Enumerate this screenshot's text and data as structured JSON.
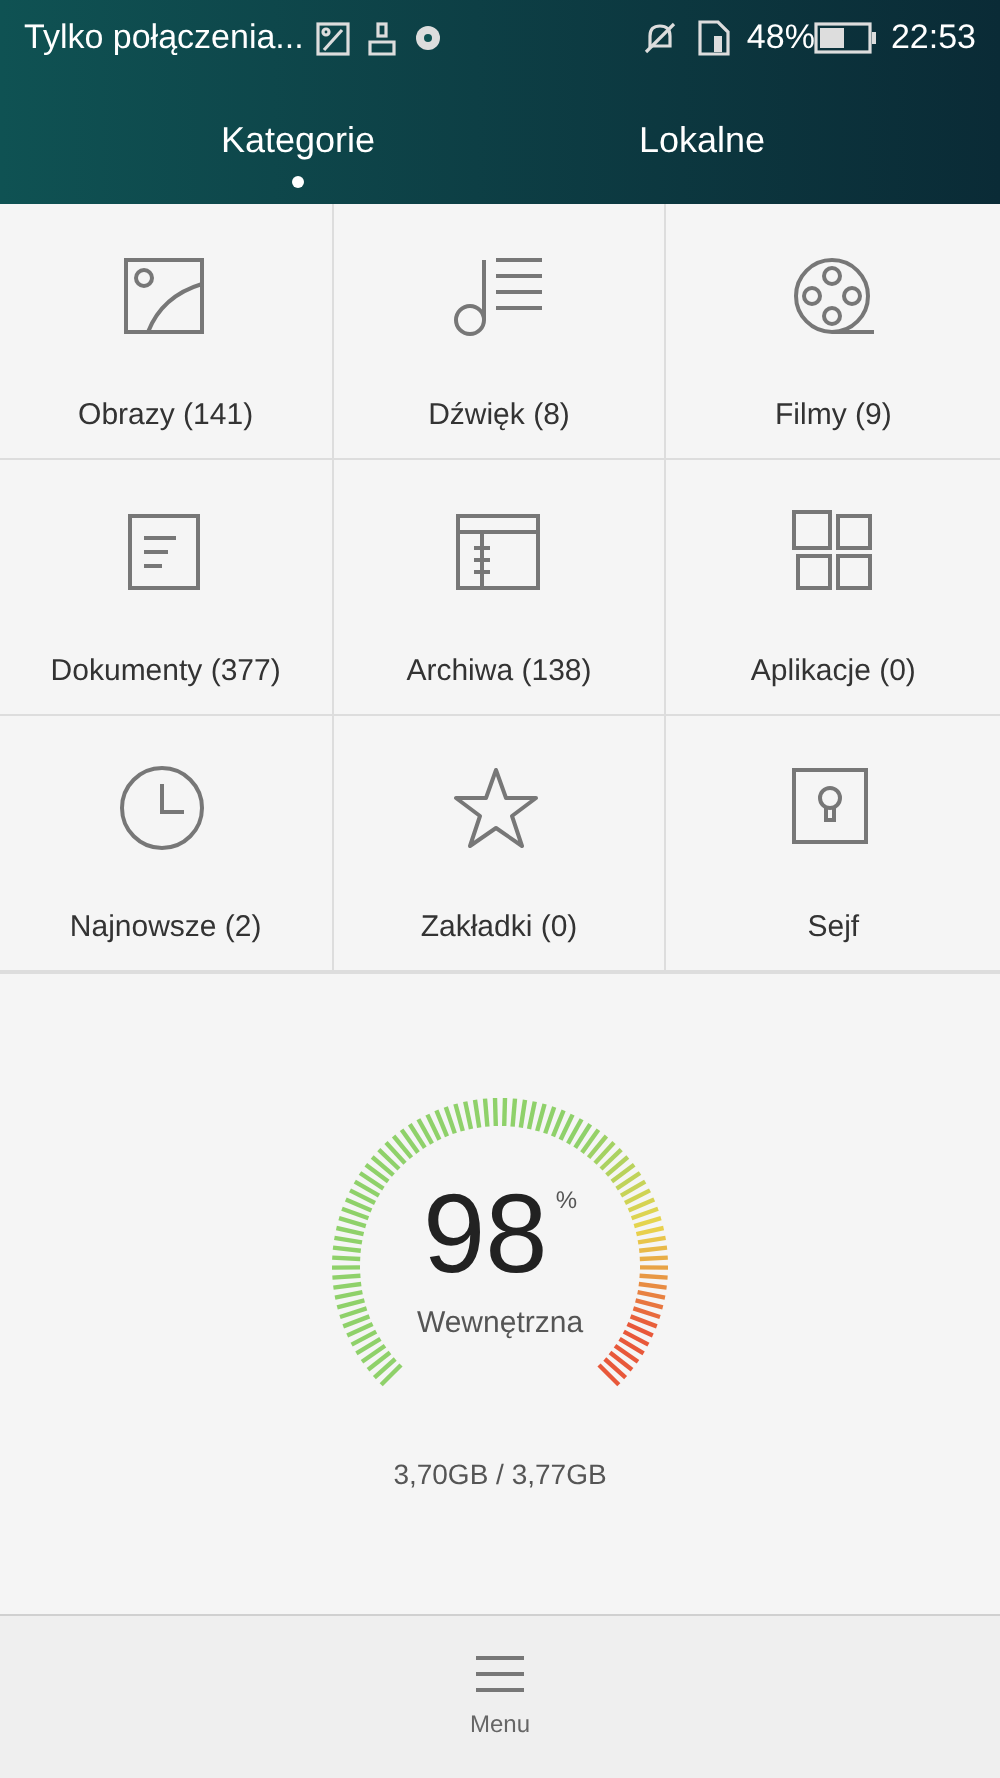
{
  "status_bar": {
    "notification": "Tylko połączenia...",
    "battery": "48%",
    "time": "22:53"
  },
  "tabs": [
    {
      "label": "Kategorie",
      "selected": true
    },
    {
      "label": "Lokalne",
      "selected": false
    }
  ],
  "categories": [
    {
      "kind": "images",
      "label": "Obrazy (141)"
    },
    {
      "kind": "audio",
      "label": "Dźwięk (8)"
    },
    {
      "kind": "video",
      "label": "Filmy (9)"
    },
    {
      "kind": "documents",
      "label": "Dokumenty (377)"
    },
    {
      "kind": "archives",
      "label": "Archiwa (138)"
    },
    {
      "kind": "apps",
      "label": "Aplikacje (0)"
    },
    {
      "kind": "recent",
      "label": "Najnowsze (2)"
    },
    {
      "kind": "bookmarks",
      "label": "Zakładki (0)"
    },
    {
      "kind": "safe",
      "label": "Sejf"
    }
  ],
  "storage": {
    "percent": "98",
    "unit": "%",
    "name": "Wewnętrzna",
    "usage": "3,70GB / 3,77GB"
  },
  "bottom_bar": {
    "label": "Menu"
  }
}
